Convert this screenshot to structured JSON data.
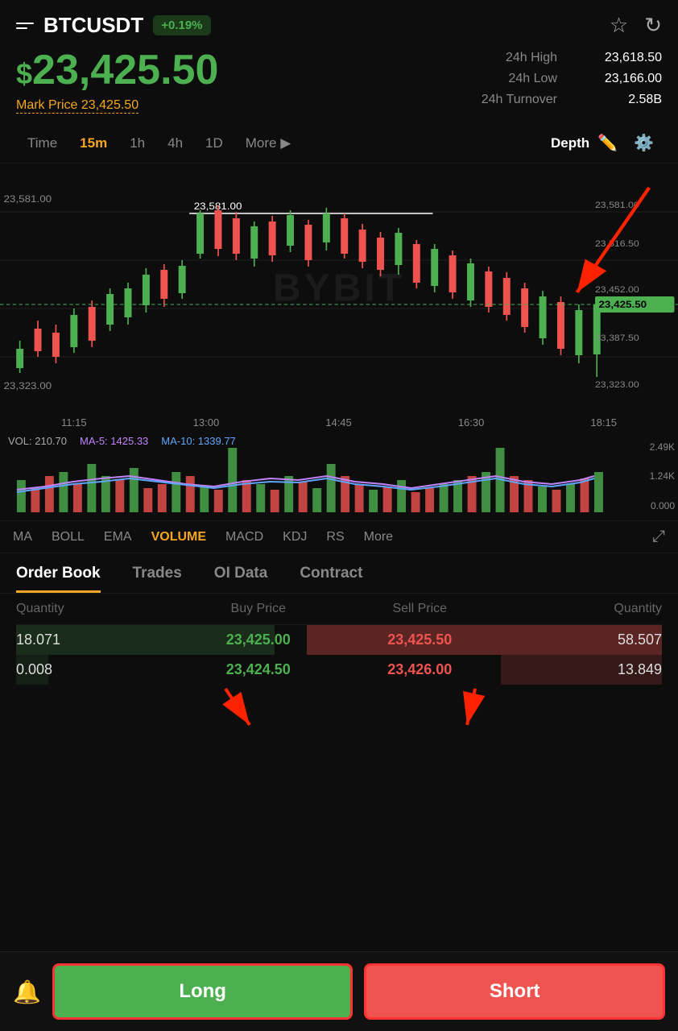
{
  "header": {
    "pair": "BTCUSDT",
    "change": "+0.19%",
    "star_icon": "☆",
    "refresh_icon": "↻"
  },
  "price": {
    "dollar_sign": "$",
    "main": "23,425.50",
    "mark_label": "Mark Price",
    "mark_value": "23,425.50"
  },
  "stats": {
    "high_label": "24h High",
    "high_value": "23,618.50",
    "low_label": "24h Low",
    "low_value": "23,166.00",
    "turnover_label": "24h Turnover",
    "turnover_value": "2.58B"
  },
  "chart_controls": {
    "time_options": [
      "Time",
      "15m",
      "1h",
      "4h",
      "1D",
      "More ▶"
    ],
    "active": "15m",
    "depth": "Depth"
  },
  "chart": {
    "watermark": "BYBIT",
    "price_levels": [
      "23,581.00",
      "23,516.50",
      "23,452.00",
      "23,387.50",
      "23,323.00"
    ],
    "current_price": "23,425.50",
    "left_levels": [
      "23,581.00",
      "23,323.00"
    ],
    "time_labels": [
      "11:15",
      "13:00",
      "14:45",
      "16:30",
      "18:15"
    ]
  },
  "volume": {
    "vol_label": "VOL: 210.70",
    "ma5_label": "MA-5: 1425.33",
    "ma10_label": "MA-10: 1339.77",
    "right_labels": [
      "2.49K",
      "1.24K",
      "0.000"
    ]
  },
  "indicators": {
    "tabs": [
      "MA",
      "BOLL",
      "EMA",
      "VOLUME",
      "MACD",
      "KDJ",
      "RS",
      "More"
    ],
    "active": "VOLUME"
  },
  "order_book_tabs": {
    "tabs": [
      "Order Book",
      "Trades",
      "OI Data",
      "Contract"
    ],
    "active": "Order Book"
  },
  "order_book": {
    "headers": {
      "qty_left": "Quantity",
      "buy_price": "Buy Price",
      "sell_price": "Sell Price",
      "qty_right": "Quantity"
    },
    "rows": [
      {
        "qty_left": "18.071",
        "buy_price": "23,425.00",
        "sell_price": "23,425.50",
        "qty_right": "58.507"
      },
      {
        "qty_left": "0.008",
        "buy_price": "23,424.50",
        "sell_price": "23,426.00",
        "qty_right": "13.849"
      }
    ]
  },
  "bottom": {
    "long_label": "Long",
    "short_label": "Short"
  }
}
